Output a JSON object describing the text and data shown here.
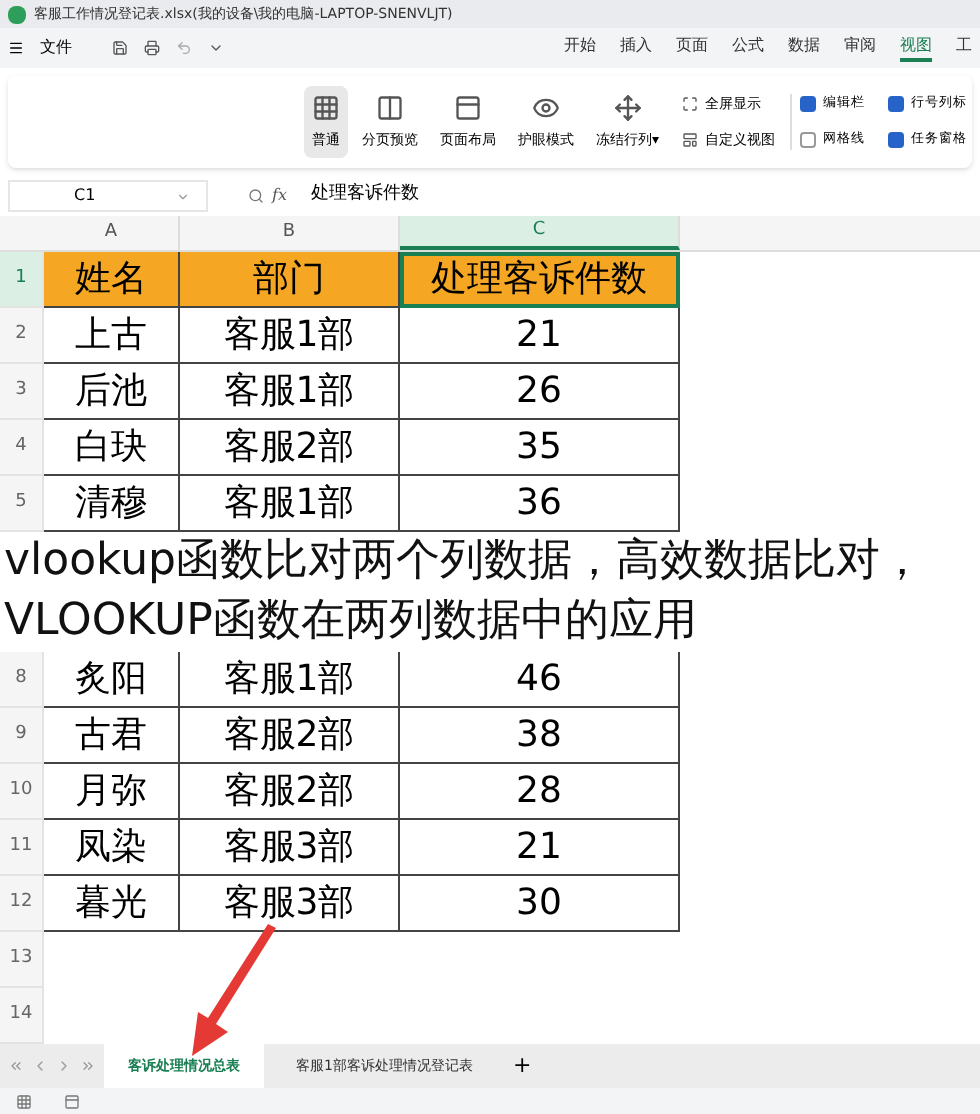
{
  "window": {
    "title": "客服工作情况登记表.xlsx(我的设备\\我的电脑-LAPTOP-SNENVLJT)"
  },
  "menu": {
    "file": "文件",
    "tabs": [
      {
        "label": "开始",
        "selected": false
      },
      {
        "label": "插入",
        "selected": false
      },
      {
        "label": "页面",
        "selected": false
      },
      {
        "label": "公式",
        "selected": false
      },
      {
        "label": "数据",
        "selected": false
      },
      {
        "label": "审阅",
        "selected": false
      },
      {
        "label": "视图",
        "selected": true
      },
      {
        "label": "工",
        "selected": false
      }
    ]
  },
  "ribbon": {
    "tools": [
      {
        "label": "普通",
        "selected": true
      },
      {
        "label": "分页预览",
        "selected": false
      },
      {
        "label": "页面布局",
        "selected": false
      },
      {
        "label": "护眼模式",
        "selected": false
      },
      {
        "label": "冻结行列▾",
        "selected": false
      }
    ],
    "small": [
      "全屏显示",
      "自定义视图"
    ],
    "checks": [
      {
        "label": "编辑栏",
        "checked": true
      },
      {
        "label": "行号列标",
        "checked": true
      },
      {
        "label": "网格线",
        "checked": false
      },
      {
        "label": "任务窗格",
        "checked": true
      }
    ]
  },
  "formula_bar": {
    "cell": "C1",
    "fx": "fx",
    "value": "处理客诉件数"
  },
  "sheet": {
    "columns": [
      {
        "label": "A",
        "selected": false
      },
      {
        "label": "B",
        "selected": false
      },
      {
        "label": "C",
        "selected": true
      }
    ],
    "rows": [
      {
        "n": "1",
        "cells": [
          "姓名",
          "部门",
          "处理客诉件数"
        ]
      },
      {
        "n": "2",
        "cells": [
          "上古",
          "客服1部",
          "21"
        ]
      },
      {
        "n": "3",
        "cells": [
          "后池",
          "客服1部",
          "26"
        ]
      },
      {
        "n": "4",
        "cells": [
          "白玦",
          "客服2部",
          "35"
        ]
      },
      {
        "n": "5",
        "cells": [
          "清穆",
          "客服1部",
          "36"
        ]
      },
      {
        "cells": []
      },
      {
        "cells": []
      },
      {
        "n": "8",
        "cells": [
          "炙阳",
          "客服1部",
          "46"
        ]
      },
      {
        "n": "9",
        "cells": [
          "古君",
          "客服2部",
          "38"
        ]
      },
      {
        "n": "10",
        "cells": [
          "月弥",
          "客服2部",
          "28"
        ]
      },
      {
        "n": "11",
        "cells": [
          "凤染",
          "客服3部",
          "21"
        ]
      },
      {
        "n": "12",
        "cells": [
          "暮光",
          "客服3部",
          "30"
        ]
      },
      {
        "n": "13",
        "cells": []
      },
      {
        "n": "14",
        "cells": []
      }
    ]
  },
  "sheet_tabs": [
    {
      "label": "客诉处理情况总表",
      "selected": true
    },
    {
      "label": "客服1部客诉处理情况登记表",
      "selected": false
    }
  ],
  "add_sheet": "+",
  "caption": "vlookup函数比对两个列数据，高效数据比对，VLOOKUP函数在两列数据中的应用"
}
